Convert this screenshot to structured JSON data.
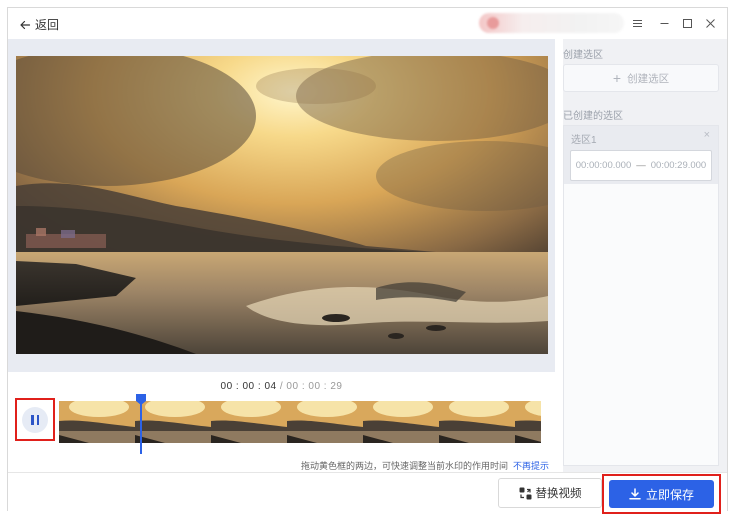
{
  "titlebar": {
    "back_label": "返回",
    "icons": [
      "arrow-left-icon",
      "menu-icon",
      "minimize-icon",
      "maximize-icon",
      "close-icon"
    ]
  },
  "player": {
    "current_time": "00 : 00 : 04",
    "separator": " / ",
    "total_time": "00 : 00 : 29",
    "hint_text": "拖动黄色框的两边，可快速调整当前水印的作用时间",
    "hint_link": "不再提示"
  },
  "panel": {
    "create_section_title": "创建选区",
    "create_button_label": "创建选区",
    "created_section_title": "已创建的选区",
    "regions": [
      {
        "name": "选区1",
        "start": "00:00:00.000",
        "end": "00:00:29.000"
      }
    ]
  },
  "footer": {
    "replace_label": "替换视频",
    "save_label": "立即保存"
  },
  "colors": {
    "accent": "#2c62e6",
    "highlight_border": "#e0201b",
    "panel_bg": "#f0f1f4"
  }
}
